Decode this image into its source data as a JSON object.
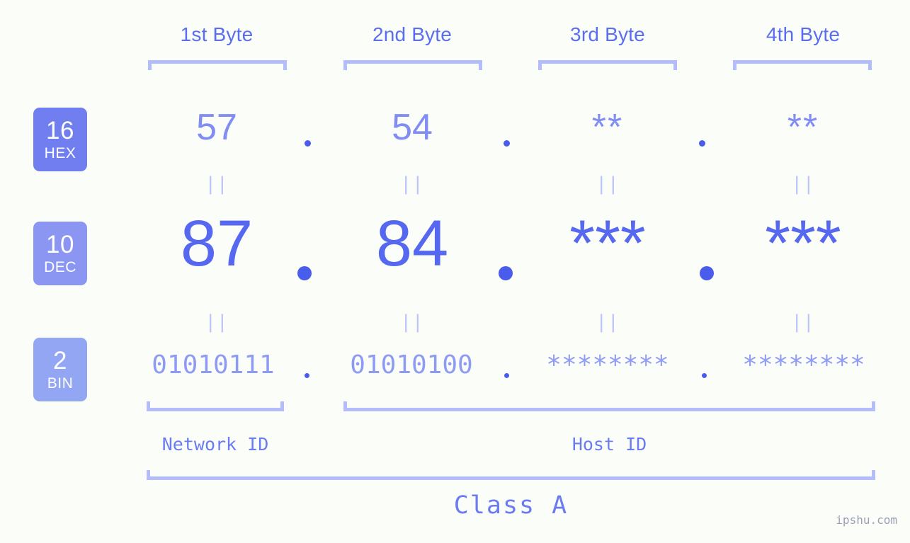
{
  "meta": {
    "background_color": "#fbfdf9",
    "accent_dark": "#5568ef",
    "accent_mid": "#818df2",
    "accent_light": "#b4bdfb"
  },
  "headers": [
    {
      "label": "1st Byte"
    },
    {
      "label": "2nd Byte"
    },
    {
      "label": "3rd Byte"
    },
    {
      "label": "4th Byte"
    }
  ],
  "rows": {
    "hex": {
      "badge_number": "16",
      "badge_label": "HEX",
      "badge_color": "#717ef0",
      "values": [
        "57",
        "54",
        "**",
        "**"
      ],
      "separator": "."
    },
    "dec": {
      "badge_number": "10",
      "badge_label": "DEC",
      "badge_color": "#8b96f2",
      "values": [
        "87",
        "84",
        "***",
        "***"
      ],
      "separator": "."
    },
    "bin": {
      "badge_number": "2",
      "badge_label": "BIN",
      "badge_color": "#93a6f4",
      "values": [
        "01010111",
        "01010100",
        "********",
        "********"
      ],
      "separator": "."
    }
  },
  "equals_marks": {
    "hex_to_dec": [
      "||",
      "||",
      "||",
      "||"
    ],
    "dec_to_bin": [
      "||",
      "||",
      "||",
      "||"
    ]
  },
  "footer": {
    "network_id_label": "Network ID",
    "host_id_label": "Host ID",
    "class_label": "Class A",
    "watermark": "ipshu.com"
  }
}
